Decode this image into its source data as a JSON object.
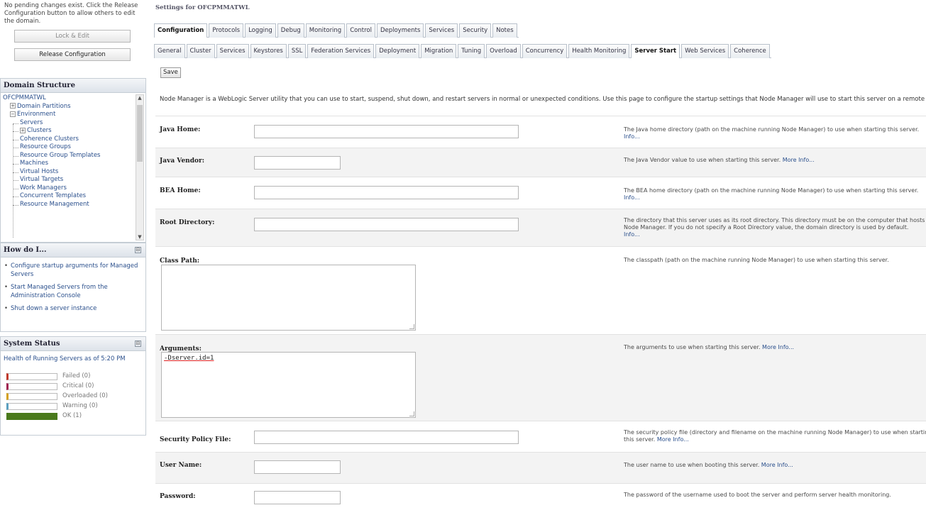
{
  "change_center": {
    "message": "No pending changes exist. Click the Release Configuration button to allow others to edit the domain.",
    "lock_edit_label": "Lock & Edit",
    "release_label": "Release Configuration"
  },
  "domain_structure": {
    "title": "Domain Structure",
    "root": "OFCPMMATWL",
    "items": [
      {
        "label": "Domain Partitions",
        "level": 1,
        "expander": "+"
      },
      {
        "label": "Environment",
        "level": 1,
        "expander": "-"
      },
      {
        "label": "Servers",
        "level": 2,
        "expander": ""
      },
      {
        "label": "Clusters",
        "level": 2,
        "expander": "+"
      },
      {
        "label": "Coherence Clusters",
        "level": 2,
        "expander": ""
      },
      {
        "label": "Resource Groups",
        "level": 2,
        "expander": ""
      },
      {
        "label": "Resource Group Templates",
        "level": 2,
        "expander": ""
      },
      {
        "label": "Machines",
        "level": 2,
        "expander": ""
      },
      {
        "label": "Virtual Hosts",
        "level": 2,
        "expander": ""
      },
      {
        "label": "Virtual Targets",
        "level": 2,
        "expander": ""
      },
      {
        "label": "Work Managers",
        "level": 2,
        "expander": ""
      },
      {
        "label": "Concurrent Templates",
        "level": 2,
        "expander": ""
      },
      {
        "label": "Resource Management",
        "level": 2,
        "expander": ""
      }
    ]
  },
  "how_do_i": {
    "title": "How do I...",
    "items": [
      "Configure startup arguments for Managed Servers",
      "Start Managed Servers from the Administration Console",
      "Shut down a server instance"
    ]
  },
  "system_status": {
    "title": "System Status",
    "health_text": "Health of Running Servers as of  5:20 PM",
    "rows": [
      {
        "label": "Failed (0)",
        "color": "#c0392b",
        "fraction": 0
      },
      {
        "label": "Critical (0)",
        "color": "#a02050",
        "fraction": 0
      },
      {
        "label": "Overloaded (0)",
        "color": "#d4a017",
        "fraction": 0
      },
      {
        "label": "Warning (0)",
        "color": "#5a9fc0",
        "fraction": 0
      },
      {
        "label": "OK (1)",
        "color": "#4a7a1c",
        "fraction": 1
      }
    ]
  },
  "main": {
    "settings_title": "Settings for OFCPMMATWL",
    "primary_tabs": [
      "Configuration",
      "Protocols",
      "Logging",
      "Debug",
      "Monitoring",
      "Control",
      "Deployments",
      "Services",
      "Security",
      "Notes"
    ],
    "primary_active": 0,
    "secondary_tabs": [
      "General",
      "Cluster",
      "Services",
      "Keystores",
      "SSL",
      "Federation Services",
      "Deployment",
      "Migration",
      "Tuning",
      "Overload",
      "Concurrency",
      "Health Monitoring",
      "Server Start",
      "Web Services",
      "Coherence"
    ],
    "secondary_active": 12,
    "save_label": "Save",
    "intro": "Node Manager is a WebLogic Server utility that you can use to start, suspend, shut down, and restart servers in normal or unexpected conditions. Use this page to configure the startup settings that Node Manager will use to start this server on a remote machine."
  },
  "fields": [
    {
      "label": "Java Home:",
      "value": "",
      "help": [
        "The Java home directory (path on the machine running Node Manager) to use when starting this server.",
        "Info..."
      ],
      "more": ""
    },
    {
      "label": "Java Vendor:",
      "value": "",
      "help": [
        "The Java Vendor value to use when starting this server."
      ],
      "more": "More Info..."
    },
    {
      "label": "BEA Home:",
      "value": "",
      "help": [
        "The BEA home directory (path on the machine running Node Manager) to use when starting this server.",
        "Info..."
      ],
      "more": ""
    },
    {
      "label": "Root Directory:",
      "value": "",
      "help": [
        "The directory that this server uses as its root directory. This directory must be on the computer that hosts",
        "Node Manager. If you do not specify a Root Directory value, the domain directory is used by default.",
        "Info..."
      ],
      "more": ""
    },
    {
      "label": "Class Path:",
      "value": "",
      "help": [
        "The classpath (path on the machine running Node Manager) to use when starting this server."
      ],
      "more": ""
    },
    {
      "label": "Arguments:",
      "value": "-Dserver.id=1",
      "help": [
        "The arguments to use when starting this server."
      ],
      "more": "More Info..."
    },
    {
      "label": "Security Policy File:",
      "value": "",
      "help": [
        "The security policy file (directory and filename on the machine running Node Manager) to use when starting",
        "this server."
      ],
      "more": "More Info..."
    },
    {
      "label": "User Name:",
      "value": "",
      "help": [
        "The user name to use when booting this server."
      ],
      "more": "More Info..."
    },
    {
      "label": "Password:",
      "value": "",
      "help": [
        "The password of the username used to boot the server and perform server health monitoring."
      ],
      "more": ""
    }
  ]
}
